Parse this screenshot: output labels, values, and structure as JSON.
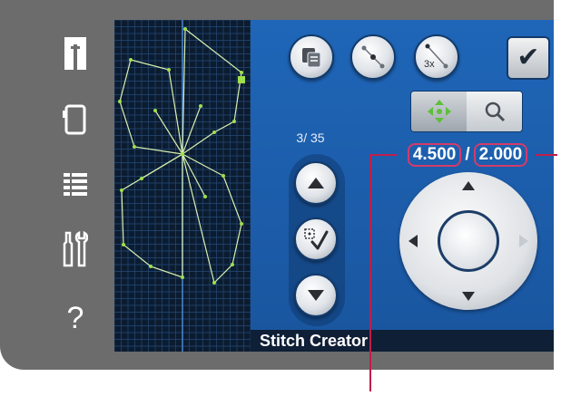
{
  "sidebar": {
    "icons": [
      {
        "name": "sewing-mode-icon"
      },
      {
        "name": "embroidery-mode-icon"
      },
      {
        "name": "menu-list-icon"
      },
      {
        "name": "settings-tools-icon"
      },
      {
        "name": "help-icon",
        "glyph": "?"
      }
    ]
  },
  "toolbar": {
    "buttons": [
      {
        "name": "duplicate-stitch-icon"
      },
      {
        "name": "insert-stitch-icon"
      },
      {
        "name": "triple-stitch-icon",
        "label": "3x"
      }
    ],
    "confirm": {
      "name": "check-icon",
      "glyph": "✔"
    }
  },
  "view_toggle": {
    "left": {
      "name": "move-icon",
      "active": true
    },
    "right": {
      "name": "zoom-icon",
      "active": false
    }
  },
  "stitch_counter": "3/ 35",
  "coordinates": {
    "x": "4.500",
    "separator": "/",
    "y": "2.000"
  },
  "status": {
    "title": "Stitch Creator"
  },
  "colors": {
    "screen_blue": "#1b5aa6",
    "grid_bg": "#0c1c30",
    "stitch_line": "#d8f0b0",
    "stitch_point": "#9ee04a",
    "highlight": "#d43b6a"
  }
}
